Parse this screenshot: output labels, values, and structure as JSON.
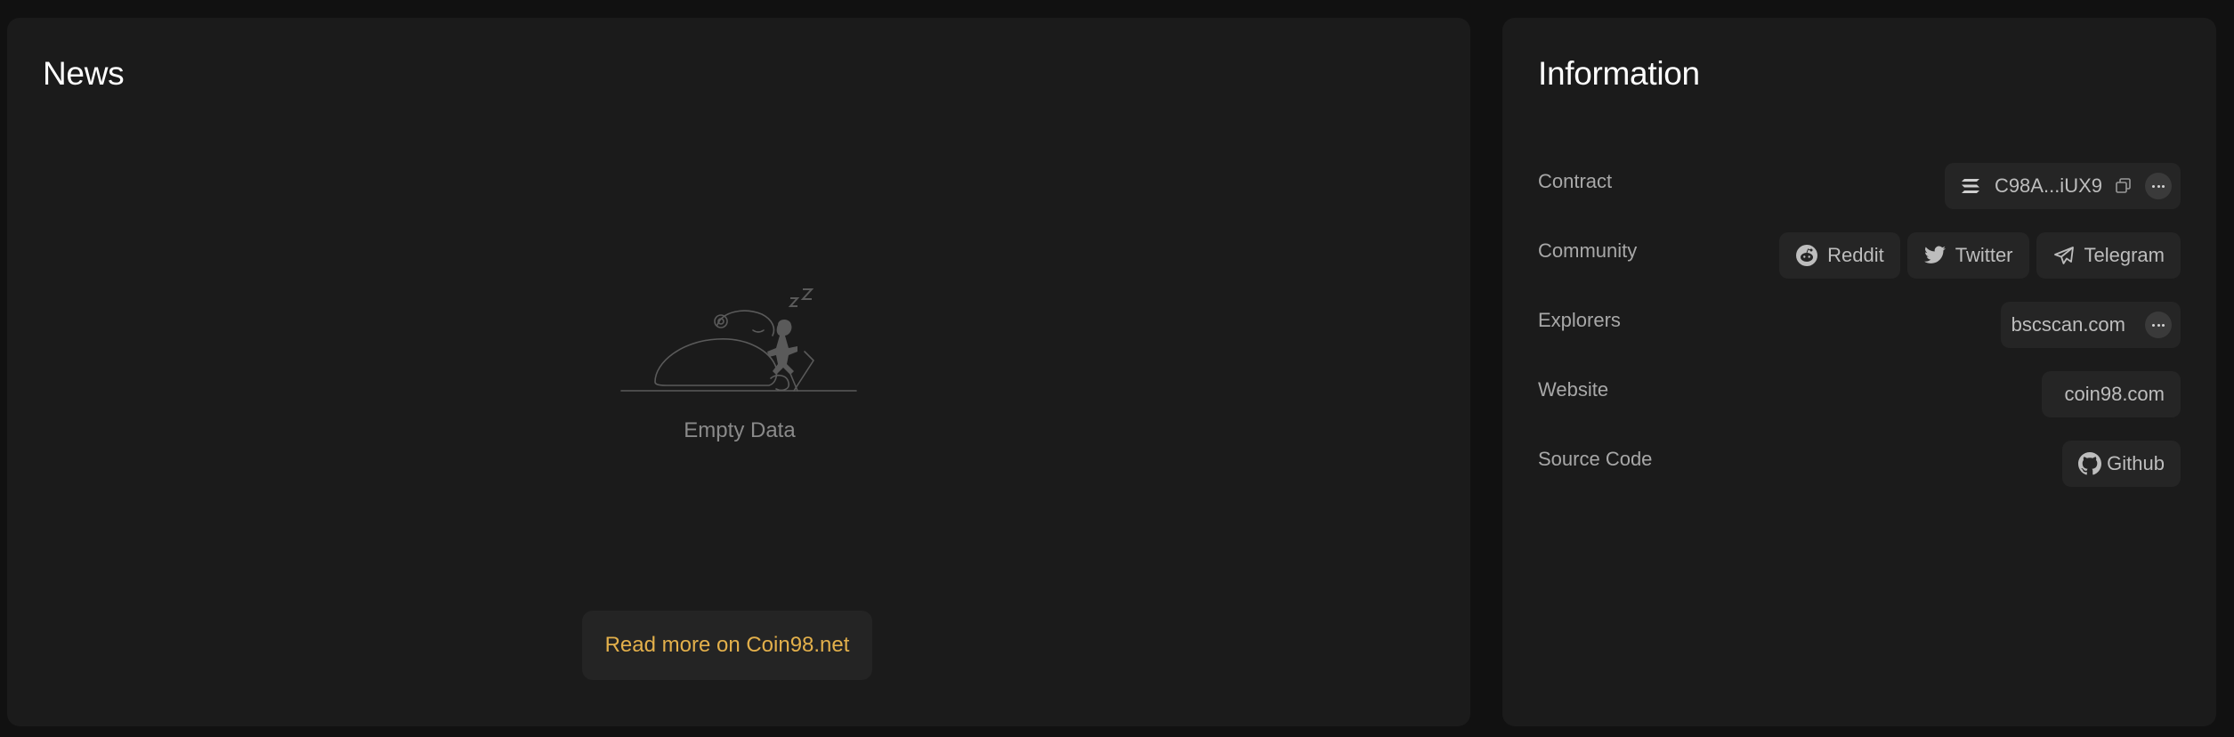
{
  "news": {
    "title": "News",
    "empty_text": "Empty Data",
    "read_more_label": "Read more on Coin98.net"
  },
  "information": {
    "title": "Information",
    "rows": {
      "contract": {
        "label": "Contract",
        "address": "C98A...iUX9",
        "chain_icon": "solana-icon"
      },
      "community": {
        "label": "Community",
        "links": [
          {
            "label": "Reddit",
            "icon": "reddit-icon"
          },
          {
            "label": "Twitter",
            "icon": "twitter-icon"
          },
          {
            "label": "Telegram",
            "icon": "telegram-icon"
          }
        ]
      },
      "explorers": {
        "label": "Explorers",
        "value": "bscscan.com"
      },
      "website": {
        "label": "Website",
        "value": "coin98.com"
      },
      "source_code": {
        "label": "Source Code",
        "value": "Github",
        "icon": "github-icon"
      }
    }
  },
  "colors": {
    "background": "#111111",
    "panel": "#1b1b1b",
    "chip": "#252525",
    "accent": "#e3b04b",
    "muted_text": "#8a8a8a"
  }
}
